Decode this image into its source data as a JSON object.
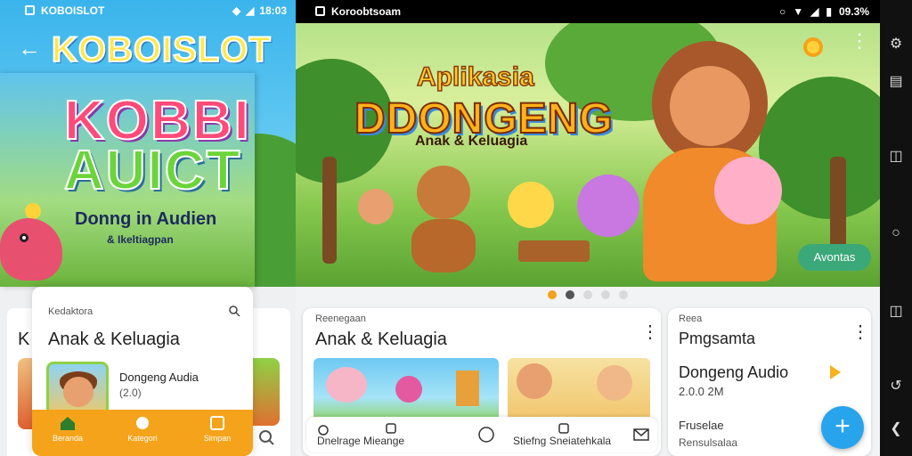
{
  "left_phone": {
    "status": {
      "app_name": "KOBOISLOT",
      "time": "18:03"
    },
    "header": {
      "logo": "KOBOISLOT"
    },
    "hero": {
      "title_line1": "KOBBI",
      "title_line2": "AUICT",
      "subtitle": "Donng in Audien",
      "subtitle_small": "& Ikeltiagpan"
    },
    "sheet": {
      "category": "Kedaktora",
      "title": "Anak & Keluagia",
      "item_title": "Dongeng Audia",
      "item_meta": "(2.0)"
    },
    "peek_left": {
      "letter": "K"
    },
    "bottom_nav": [
      {
        "label": "Beranda"
      },
      {
        "label": "Kategori"
      },
      {
        "label": "Simpan"
      }
    ]
  },
  "right_phone": {
    "status": {
      "app_name": "Koroobtsoam",
      "battery": "09.3%"
    },
    "hero": {
      "title_line1": "Aplikasia",
      "title_line2": "DDONGENG",
      "title_line3": "Anak & Keluagia",
      "pill": "Avontas"
    },
    "card_left": {
      "category": "Reenegaan",
      "title": "Anak & Keluagia",
      "bar_label1": "Dnelrage Mieange",
      "bar_label2": "Stiefng Sneiatehkala"
    },
    "card_right": {
      "category": "Reea",
      "title": "Pmgsamta",
      "item_title": "Dongeng Audio",
      "item_meta": "2.0.0 2M",
      "item_label": "Fruselae",
      "item_sub": "Rensulsalaa"
    },
    "fab": "+"
  },
  "icons": [
    "back-arrow-icon",
    "search-icon",
    "home-icon",
    "category-icon",
    "bookmark-icon",
    "more-icon",
    "play-icon",
    "add-icon",
    "wifi-icon",
    "signal-icon",
    "battery-icon"
  ],
  "colors": {
    "accent": "#f5a31a",
    "fab": "#27a4ec",
    "pill": "#3aa878"
  }
}
